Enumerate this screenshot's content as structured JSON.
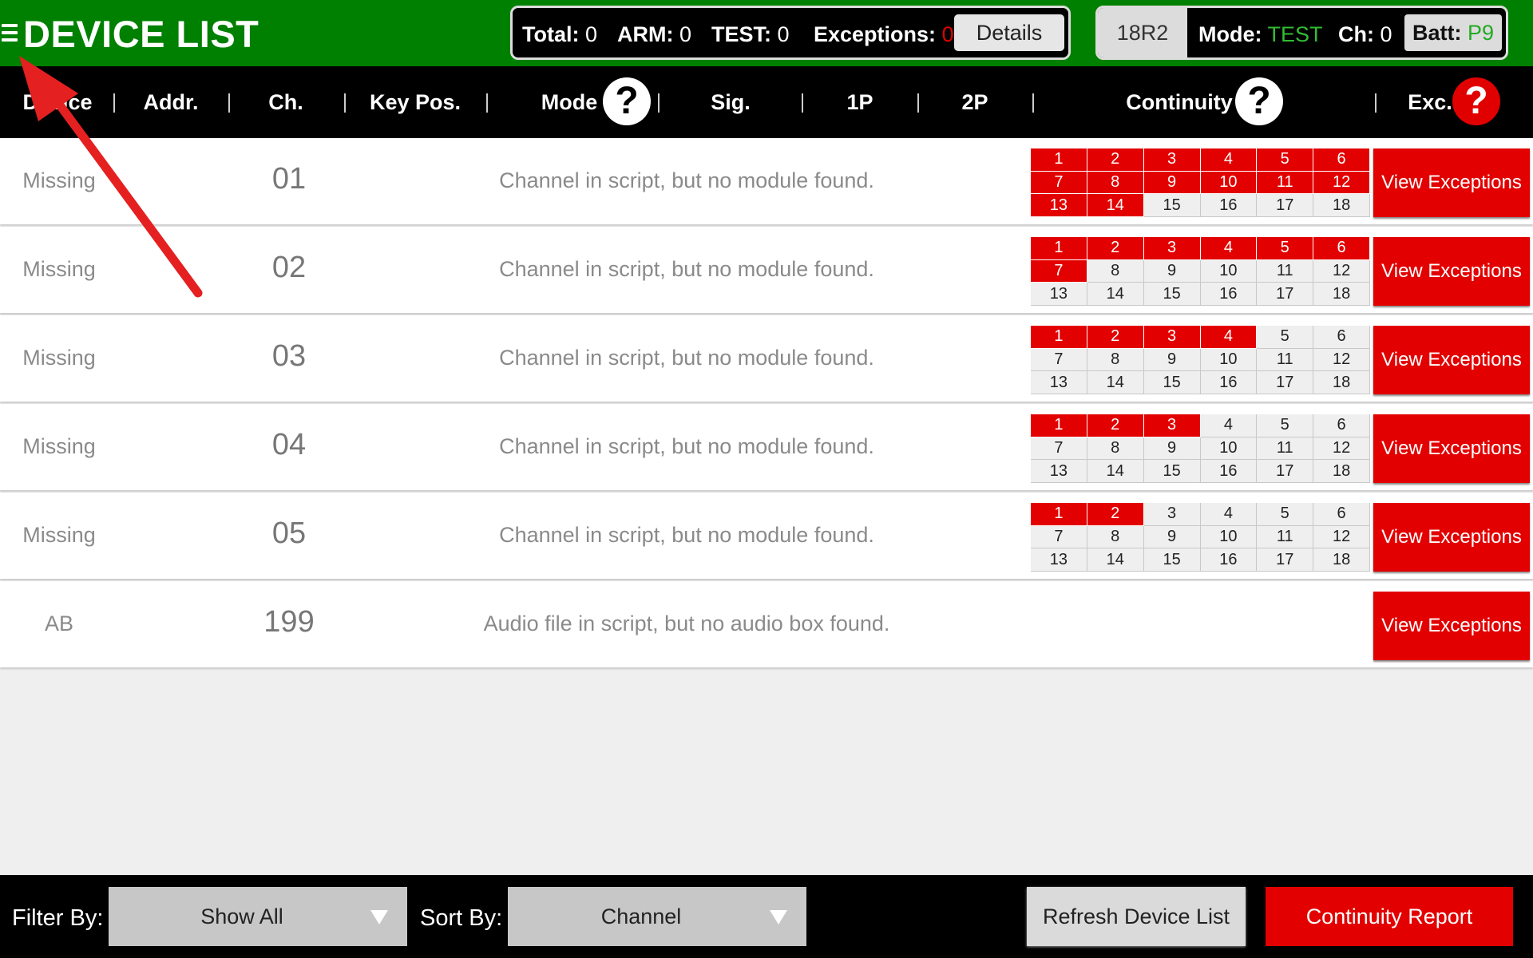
{
  "header": {
    "title": "DEVICE LIST",
    "stats": {
      "total_label": "Total:",
      "total_value": "0",
      "arm_label": "ARM:",
      "arm_value": "0",
      "test_label": "TEST:",
      "test_value": "0",
      "exceptions_label": "Exceptions:",
      "exceptions_value": "0",
      "details_label": "Details"
    },
    "device": {
      "id": "18R2",
      "mode_label": "Mode:",
      "mode_value": "TEST",
      "ch_label": "Ch:",
      "ch_value": "0",
      "batt_label": "Batt:",
      "batt_value": "P9"
    }
  },
  "columns": {
    "device": "Device",
    "addr": "Addr.",
    "ch": "Ch.",
    "key_pos": "Key Pos.",
    "mode": "Mode",
    "sig": "Sig.",
    "p1": "1P",
    "p2": "2P",
    "continuity": "Continuity",
    "exc": "Exc.",
    "help_glyph": "?"
  },
  "rows": [
    {
      "device": "Missing",
      "addr": "01",
      "message": "Channel in script, but no module found.",
      "active_count": 14,
      "button": "View Exceptions"
    },
    {
      "device": "Missing",
      "addr": "02",
      "message": "Channel in script, but no module found.",
      "active_count": 7,
      "button": "View Exceptions"
    },
    {
      "device": "Missing",
      "addr": "03",
      "message": "Channel in script, but no module found.",
      "active_count": 4,
      "button": "View Exceptions"
    },
    {
      "device": "Missing",
      "addr": "04",
      "message": "Channel in script, but no module found.",
      "active_count": 3,
      "button": "View Exceptions"
    },
    {
      "device": "Missing",
      "addr": "05",
      "message": "Channel in script, but no module found.",
      "active_count": 2,
      "button": "View Exceptions"
    },
    {
      "device": "AB",
      "addr": "199",
      "message": "Audio file in script, but no audio box found.",
      "active_count": 0,
      "button": "View Exceptions"
    }
  ],
  "continuity_cells": [
    "1",
    "2",
    "3",
    "4",
    "5",
    "6",
    "7",
    "8",
    "9",
    "10",
    "11",
    "12",
    "13",
    "14",
    "15",
    "16",
    "17",
    "18"
  ],
  "footer": {
    "filter_label": "Filter By:",
    "filter_value": "Show All",
    "sort_label": "Sort By:",
    "sort_value": "Channel",
    "refresh_label": "Refresh Device List",
    "continuity_label": "Continuity Report"
  },
  "colors": {
    "topbar": "#008000",
    "accent_red": "#e20000",
    "mode_green": "#33bb33"
  },
  "icons": {
    "menu": "hamburger-icon",
    "help": "question-mark-icon",
    "dropdown": "triangle-down-icon",
    "annotation": "red-arrow-icon"
  }
}
